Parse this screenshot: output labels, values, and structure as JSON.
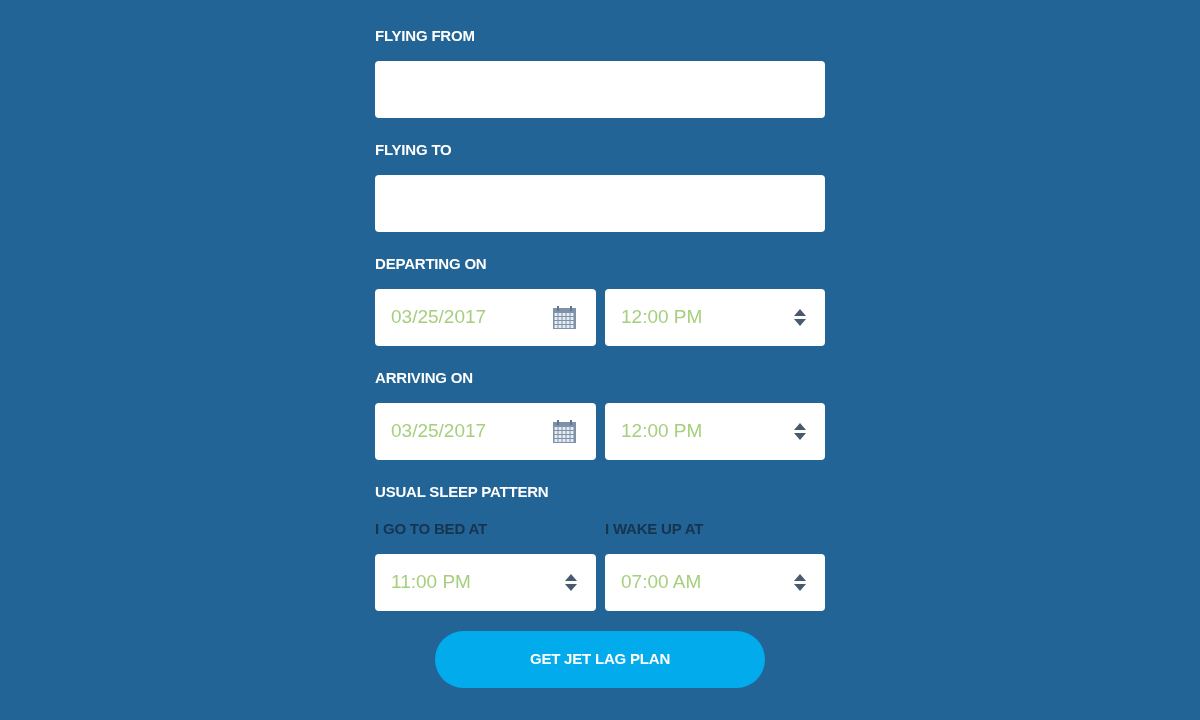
{
  "fields": [
    {
      "kind": "text",
      "label": "FLYING FROM"
    },
    {
      "kind": "text",
      "label": "FLYING TO"
    },
    {
      "kind": "datetime",
      "label": "DEPARTING ON",
      "date": "03/25/2017",
      "time": "12:00 PM"
    },
    {
      "kind": "datetime",
      "label": "ARRIVING ON",
      "date": "03/25/2017",
      "time": "12:00 PM"
    }
  ],
  "sleep_pattern": {
    "label": "USUAL SLEEP PATTERN",
    "times": [
      {
        "label": "I GO TO BED AT",
        "value": "11:00 PM"
      },
      {
        "label": "I WAKE UP AT",
        "value": "07:00 AM"
      }
    ]
  },
  "button": "GET JET LAG PLAN"
}
